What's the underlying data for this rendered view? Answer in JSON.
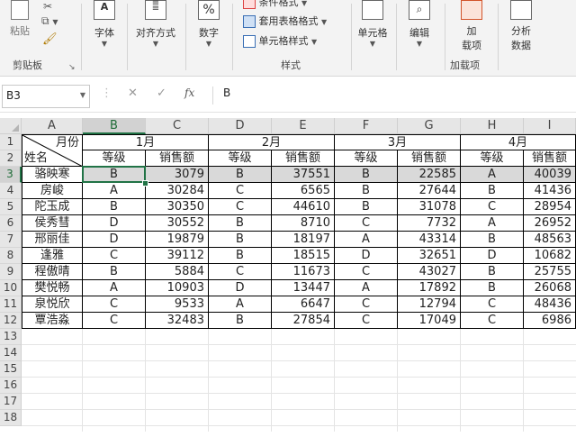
{
  "ribbon": {
    "clipboard": {
      "paste": "粘贴",
      "group": "剪贴板"
    },
    "font": {
      "label": "字体"
    },
    "align": {
      "label": "对齐方式"
    },
    "number": {
      "label": "数字",
      "icon_text": "%"
    },
    "styles": {
      "item1": "条件格式",
      "item2": "套用表格格式",
      "item3": "单元格样式",
      "group": "样式"
    },
    "cells": {
      "label": "单元格"
    },
    "editing": {
      "label": "编辑"
    },
    "addins": {
      "label1": "加",
      "label2": "载项",
      "group": "加载项"
    },
    "analyze": {
      "label1": "分析",
      "label2": "数据"
    }
  },
  "formula_bar": {
    "name_box": "B3",
    "fx": "fx",
    "content": "B"
  },
  "columns": [
    "A",
    "B",
    "C",
    "D",
    "E",
    "F",
    "G",
    "H",
    "I"
  ],
  "rows": [
    "1",
    "2",
    "3",
    "4",
    "5",
    "6",
    "7",
    "8",
    "9",
    "10",
    "11",
    "12",
    "13",
    "14",
    "15",
    "16",
    "17",
    "18"
  ],
  "table": {
    "corner_top": "月份",
    "corner_bottom": "姓名",
    "months": [
      "1月",
      "2月",
      "3月",
      "4月"
    ],
    "sub_headers": [
      "等级",
      "销售额",
      "等级",
      "销售额",
      "等级",
      "销售额",
      "等级",
      "销售额"
    ],
    "data": [
      [
        "骆映寒",
        "B",
        "3079",
        "B",
        "37551",
        "B",
        "22585",
        "A",
        "40039"
      ],
      [
        "房峻",
        "A",
        "30284",
        "C",
        "6565",
        "B",
        "27644",
        "B",
        "41436"
      ],
      [
        "陀玉成",
        "B",
        "30350",
        "C",
        "44610",
        "B",
        "31078",
        "C",
        "28954"
      ],
      [
        "侯秀彗",
        "D",
        "30552",
        "B",
        "8710",
        "C",
        "7732",
        "A",
        "26952"
      ],
      [
        "邢丽佳",
        "D",
        "19879",
        "B",
        "18197",
        "A",
        "43314",
        "B",
        "48563"
      ],
      [
        "逢雅",
        "C",
        "39112",
        "B",
        "18515",
        "D",
        "32651",
        "D",
        "10682"
      ],
      [
        "程傲晴",
        "B",
        "5884",
        "C",
        "11673",
        "C",
        "43027",
        "B",
        "25755"
      ],
      [
        "樊悦畅",
        "A",
        "10903",
        "D",
        "13447",
        "A",
        "17892",
        "B",
        "26068"
      ],
      [
        "泉悦欣",
        "C",
        "9533",
        "A",
        "6647",
        "C",
        "12794",
        "C",
        "48436"
      ],
      [
        "覃浩淼",
        "C",
        "32483",
        "B",
        "27854",
        "C",
        "17049",
        "C",
        "6986"
      ]
    ]
  }
}
